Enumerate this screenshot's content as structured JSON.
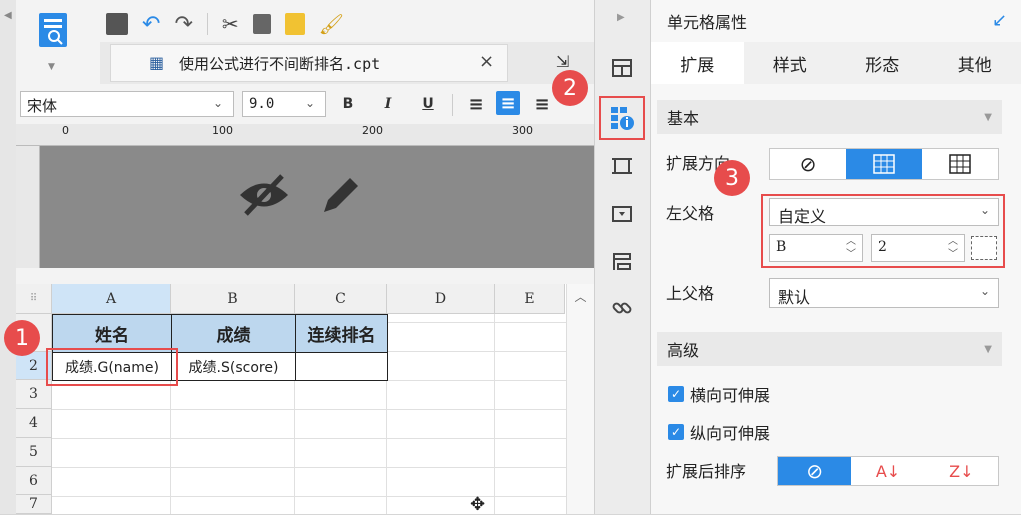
{
  "tab": {
    "title": "使用公式进行不间断排名.cpt"
  },
  "format": {
    "font": "宋体",
    "size": "9.0",
    "bold": "B",
    "italic": "I",
    "underline": "U"
  },
  "ruler": {
    "t0": "0",
    "t100": "100",
    "t200": "200",
    "t300": "300"
  },
  "grid": {
    "columns": [
      "A",
      "B",
      "C",
      "D",
      "E"
    ],
    "rows": [
      "1",
      "2",
      "3",
      "4",
      "5",
      "6",
      "7"
    ],
    "header_cells": [
      "姓名",
      "成绩",
      "连续排名"
    ],
    "data_cells": [
      "成绩.G(name)",
      "成绩.S(score)",
      ""
    ]
  },
  "badges": [
    "1",
    "2",
    "3"
  ],
  "panel": {
    "title": "单元格属性",
    "tabs": [
      "扩展",
      "样式",
      "形态",
      "其他"
    ],
    "section_basic": "基本",
    "expand_dir_label": "扩展方向",
    "left_parent_label": "左父格",
    "left_parent_value": "自定义",
    "left_parent_col": "B",
    "left_parent_row": "2",
    "upper_parent_label": "上父格",
    "upper_parent_value": "默认",
    "section_advanced": "高级",
    "h_stretch": "横向可伸展",
    "v_stretch": "纵向可伸展",
    "sort_label": "扩展后排序"
  },
  "colors": {
    "accent": "#2b8ae6",
    "annot": "#e74c4c",
    "header_fill": "#bdd7ee"
  }
}
